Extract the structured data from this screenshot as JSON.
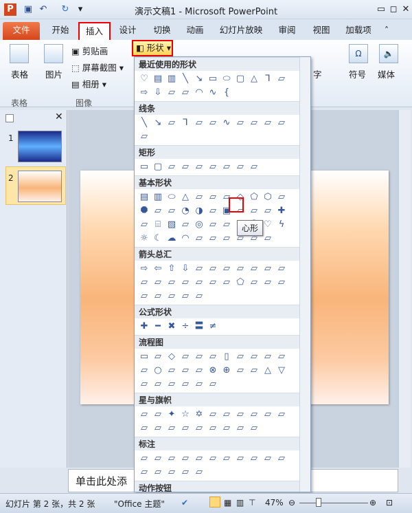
{
  "window": {
    "title": "演示文稿1  -  Microsoft PowerPoint",
    "controls": [
      "minimize",
      "restore",
      "close"
    ]
  },
  "quick_access": [
    "powerpoint-logo",
    "save",
    "undo",
    "redo",
    "customize"
  ],
  "tabs": [
    {
      "label": "文件"
    },
    {
      "label": "开始"
    },
    {
      "label": "插入",
      "active": true
    },
    {
      "label": "设计"
    },
    {
      "label": "切换"
    },
    {
      "label": "动画"
    },
    {
      "label": "幻灯片放映"
    },
    {
      "label": "审阅"
    },
    {
      "label": "视图"
    },
    {
      "label": "加载项"
    }
  ],
  "ribbon": {
    "table": {
      "button": "表格",
      "group": "表格"
    },
    "image": {
      "picture": "图片",
      "clipart": "剪贴画",
      "screenshot": "屏幕截图",
      "album": "相册",
      "group": "图像"
    },
    "shapes": "形状",
    "text_partial": "字",
    "symbol": "符号",
    "media": "媒体"
  },
  "dropdown": {
    "sections": [
      {
        "title": "最近使用的形状",
        "shapes": [
          "heart",
          "textbox",
          "vtextbox",
          "line",
          "arrow-line",
          "rect",
          "oval",
          "roundrect",
          "triangle",
          "elbow",
          "elbow-arrow",
          "right-arrow",
          "down-arrow",
          "cloud-ish",
          "freeform",
          "arc",
          "curve",
          "brace"
        ]
      },
      {
        "title": "线条",
        "shapes": [
          "line",
          "arrow-line",
          "double-arrow",
          "elbow",
          "elbow-arrow",
          "elbow-double",
          "curve",
          "curve-arrow",
          "curve-double",
          "curve2",
          "freeform",
          "scribble"
        ]
      },
      {
        "title": "矩形",
        "shapes": [
          "rect",
          "roundrect",
          "snip1",
          "snip2",
          "snip3",
          "snipround",
          "round1",
          "round2",
          "round3"
        ]
      },
      {
        "title": "基本形状",
        "shapes": [
          "textbox",
          "vtextbox",
          "oval",
          "triangle",
          "rtriangle",
          "parallelogram",
          "trapezoid",
          "diamond",
          "pentagon",
          "hexagon",
          "heptagon",
          "octagon",
          "decagon",
          "dodecagon",
          "pie",
          "chord",
          "teardrop",
          "frame",
          "halfframe",
          "lshape",
          "diagstripe",
          "cross",
          "plaque",
          "can",
          "cube",
          "bevel",
          "donut",
          "nosmoking",
          "blockarc",
          "foldedcorner",
          "smiley",
          "heart",
          "lightning",
          "sun",
          "moon",
          "cloud",
          "arc",
          "bracketpair",
          "bracepair",
          "leftbracket",
          "rightbracket",
          "leftbrace",
          "rightbrace"
        ]
      },
      {
        "title": "箭头总汇",
        "shapes": [
          "right",
          "left",
          "up",
          "down",
          "leftright",
          "updown",
          "quad",
          "leftrightup",
          "bent",
          "uturn",
          "leftup",
          "bentup",
          "curvedright",
          "curvedleft",
          "curvedup",
          "curveddown",
          "striped",
          "notched",
          "pentagon",
          "chevron",
          "rightcallout",
          "downcallout",
          "leftcallout",
          "upcallout",
          "lrcallout",
          "quadcallout",
          "circular"
        ]
      },
      {
        "title": "公式形状",
        "shapes": [
          "plus",
          "minus",
          "multiply",
          "divide",
          "equal",
          "notequal"
        ]
      },
      {
        "title": "流程图",
        "shapes": [
          "process",
          "altprocess",
          "decision",
          "data",
          "predefined",
          "internal",
          "document",
          "multidoc",
          "terminator",
          "preparation",
          "manualinput",
          "manualop",
          "connector",
          "offpage",
          "card",
          "punchedtape",
          "summing",
          "or",
          "collate",
          "sort",
          "extract",
          "merge",
          "storeddata",
          "delay",
          "seqaccess",
          "magneticdisk",
          "directaccess",
          "display"
        ]
      },
      {
        "title": "星与旗帜",
        "shapes": [
          "explosion1",
          "explosion2",
          "star4",
          "star5",
          "star6",
          "star7",
          "star8",
          "star10",
          "star12",
          "star16",
          "star24",
          "star32",
          "ribbonup",
          "ribbondown",
          "curvedup",
          "curveddown",
          "vscroll",
          "hscroll",
          "wave",
          "doublewave"
        ]
      },
      {
        "title": "标注",
        "shapes": [
          "rectcallout",
          "roundcallout",
          "ovalcallout",
          "cloudcallout",
          "line1",
          "line2",
          "line3",
          "accent1",
          "accent2",
          "accent3",
          "border1",
          "border2",
          "border3",
          "accentborder1",
          "accentborder2",
          "accentborder3"
        ]
      },
      {
        "title": "动作按钮",
        "shapes": [
          "back",
          "forward",
          "beginning",
          "end",
          "home",
          "info",
          "return",
          "movie",
          "document",
          "sound",
          "help",
          "custom"
        ]
      }
    ]
  },
  "tooltip": "心形",
  "slides": [
    {
      "number": "1"
    },
    {
      "number": "2",
      "selected": true
    }
  ],
  "notes_placeholder": "单击此处添",
  "status": {
    "slide_info": "幻灯片 第 2 张，共 2 张",
    "theme": "\"Office 主题\"",
    "zoom": "47%",
    "zoom_value": 47
  },
  "colors": {
    "accent": "#d6461c",
    "highlight": "#ee0000",
    "shape_icon": "#36589a"
  }
}
